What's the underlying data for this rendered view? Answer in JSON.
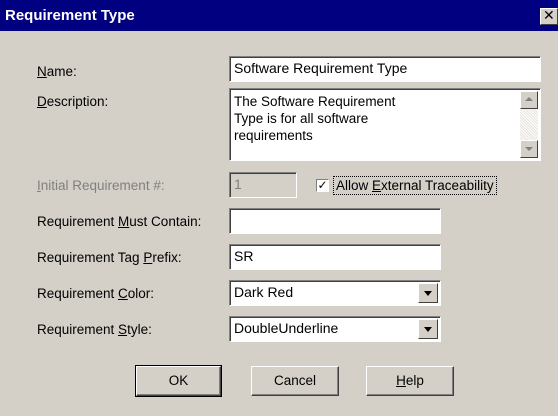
{
  "window": {
    "title": "Requirement Type",
    "close_glyph": "✕"
  },
  "labels": {
    "name": {
      "pre": "",
      "key": "N",
      "post": "ame:"
    },
    "description": {
      "pre": "",
      "key": "D",
      "post": "escription:"
    },
    "initial_number": {
      "pre": "",
      "key": "I",
      "post": "nitial Requirement #:"
    },
    "must_contain": {
      "pre": "Requirement ",
      "key": "M",
      "post": "ust Contain:"
    },
    "tag_prefix": {
      "pre": "Requirement Tag ",
      "key": "P",
      "post": "refix:"
    },
    "color": {
      "pre": "Requirement ",
      "key": "C",
      "post": "olor:"
    },
    "style": {
      "pre": "Requirement ",
      "key": "S",
      "post": "tyle:"
    }
  },
  "fields": {
    "name_value": "Software Requirement Type",
    "description_value": "The Software Requirement Type is for all software requirements",
    "initial_number_value": "1",
    "must_contain_value": "",
    "tag_prefix_value": "SR",
    "color_selected": "Dark Red",
    "style_selected": "DoubleUnderline"
  },
  "checkbox": {
    "checked_glyph": "✓",
    "label": {
      "pre": "Allow ",
      "key": "E",
      "post": "xternal Traceability"
    },
    "checked": true
  },
  "buttons": {
    "ok": "OK",
    "cancel": "Cancel",
    "help": {
      "pre": "",
      "key": "H",
      "post": "elp"
    }
  },
  "icons": [
    "close-icon",
    "scroll-up-icon",
    "scroll-down-icon",
    "dropdown-arrow-icon",
    "checkmark-icon"
  ],
  "colors": {
    "titlebar": "#000080",
    "dialog_bg": "#d4d0c8",
    "disabled_text": "#808080"
  }
}
